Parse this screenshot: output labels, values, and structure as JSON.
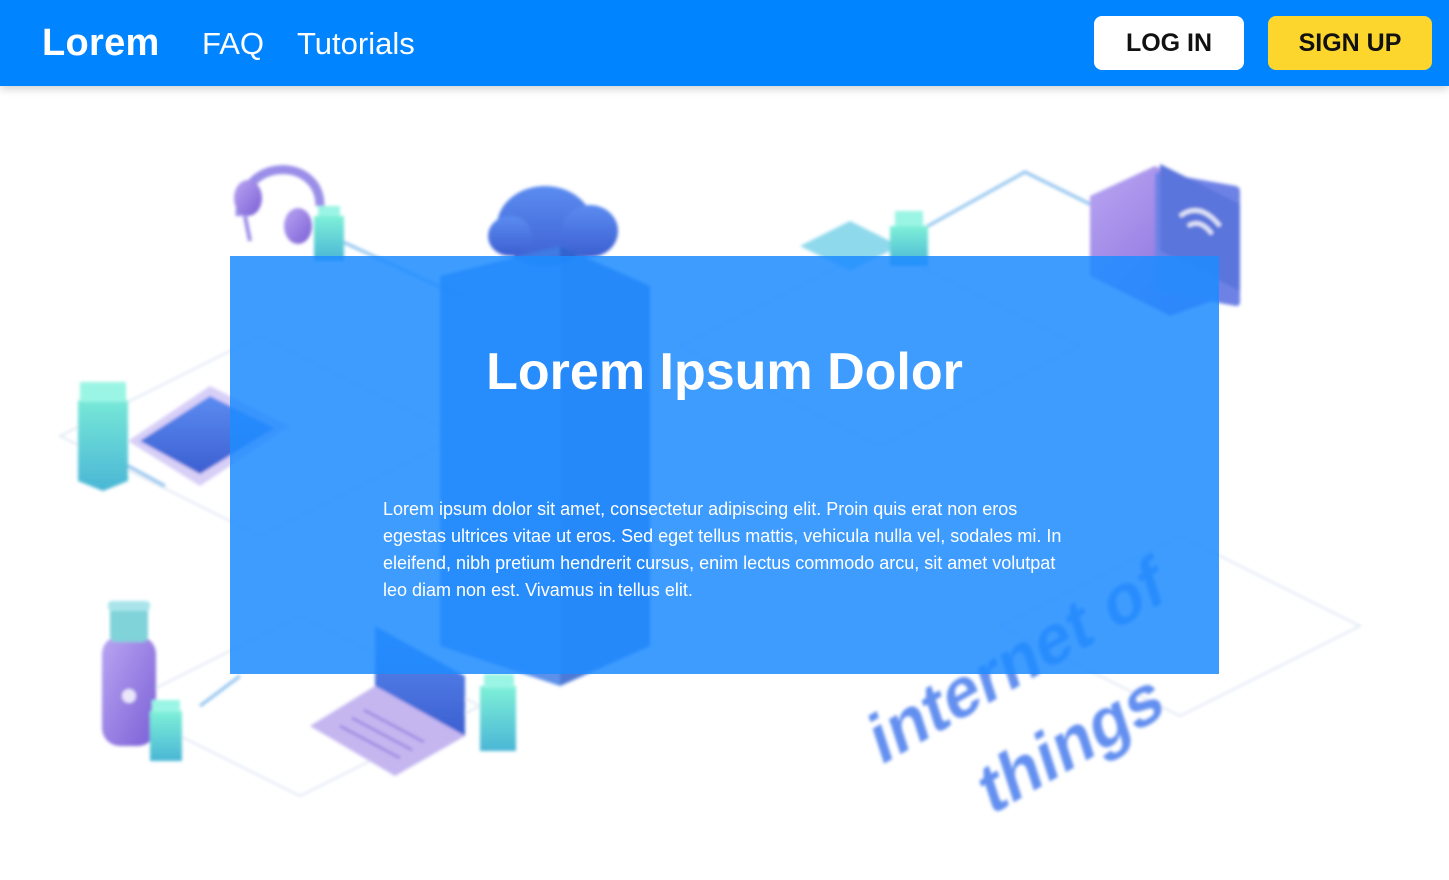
{
  "navbar": {
    "brand": "Lorem",
    "links": [
      "FAQ",
      "Tutorials"
    ],
    "login_label": "LOG IN",
    "signup_label": "SIGN UP",
    "bg_color": "#0084ff",
    "signup_color": "#fcd62c"
  },
  "hero": {
    "title": "Lorem Ipsum Dolor",
    "body": "Lorem ipsum dolor sit amet, consectetur adipiscing elit. Proin quis erat non eros egestas ultrices vitae ut eros. Sed eget tellus mattis, vehicula nulla vel, sodales mi. In eleifend, nibh pretium hendrerit cursus, enim lectus commodo arcu, sit amet volutpat leo diam non est. Vivamus in tellus elit.",
    "card_color": "#1e8cff",
    "illustration_text": "internet of things"
  }
}
